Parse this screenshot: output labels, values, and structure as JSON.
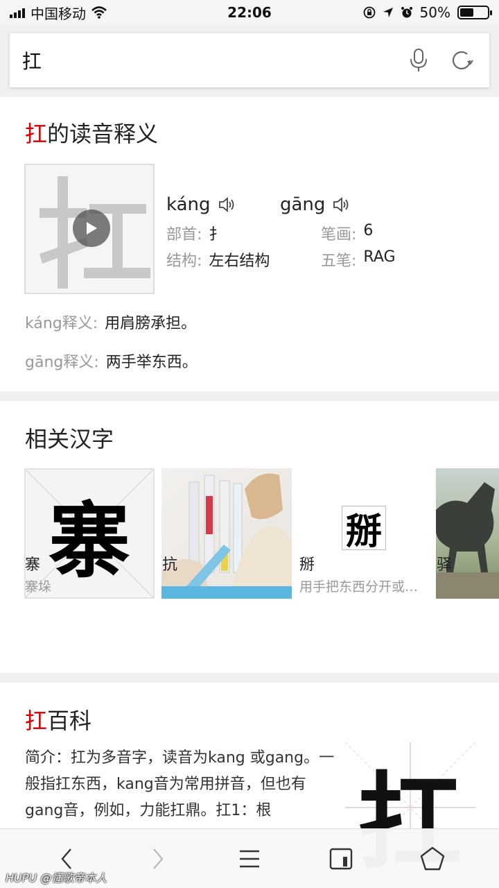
{
  "status_bar": {
    "carrier": "中国移动",
    "time": "22:06",
    "battery": "50%",
    "battery_level": 0.5
  },
  "search": {
    "query": "扛"
  },
  "reading_card": {
    "title_char": "扛",
    "title_rest": "的读音释义",
    "pron1": "káng",
    "pron2": "gāng",
    "radical_label": "部首:",
    "radical_value": "扌",
    "strokes_label": "笔画:",
    "strokes_value": "6",
    "structure_label": "结构:",
    "structure_value": "左右结构",
    "wubi_label": "五笔:",
    "wubi_value": "RAG",
    "meaning1_label": "káng释义:",
    "meaning1_value": "用肩膀承担。",
    "meaning2_label": "gāng释义:",
    "meaning2_value": "两手举东西。"
  },
  "related_card": {
    "title": "相关汉字",
    "items": [
      {
        "char": "寨",
        "desc": "寨垛",
        "glyph": "寨"
      },
      {
        "char": "抗",
        "desc": ""
      },
      {
        "char": "掰",
        "desc": "用手把东西分开或…",
        "glyph": "掰"
      },
      {
        "char": "驿",
        "desc": ""
      }
    ]
  },
  "baike_card": {
    "title_char": "扛",
    "title_rest": "百科",
    "text": "简介：扛为多音字，读音为kang 或gang。一般指扛东西，kang音为常用拼音，但也有gang音，例如，力能扛鼎。扛1：根",
    "glyph": "扛"
  },
  "watermark": "@懂歌帝本人",
  "watermark_brand": "HUPU",
  "colors": {
    "accent_red": "#d40000",
    "label_gray": "#999999"
  }
}
